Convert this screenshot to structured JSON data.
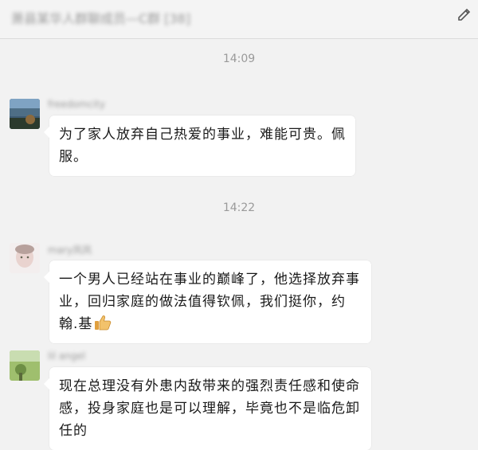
{
  "chat": {
    "title": "萧县某华人群聊成员—C群 [38]"
  },
  "timestamps": [
    "14:09",
    "14:22"
  ],
  "messages": [
    {
      "sender": "freedomcity",
      "text": "为了家人放弃自己热爱的事业，难能可贵。佩服。"
    },
    {
      "sender": "mary凤凤",
      "text": "一个男人已经站在事业的巅峰了，他选择放弃事业，回归家庭的做法值得钦佩，我们挺你，约翰.基",
      "emoji": "thumbs-up"
    },
    {
      "sender": "lil angel",
      "text": "现在总理没有外患内敌带来的强烈责任感和使命感，投身家庭也是可以理解，毕竟也不是临危卸任的"
    }
  ],
  "icons": {
    "header": "edit-icon",
    "message_2_emoji": "thumbs-up-icon"
  }
}
